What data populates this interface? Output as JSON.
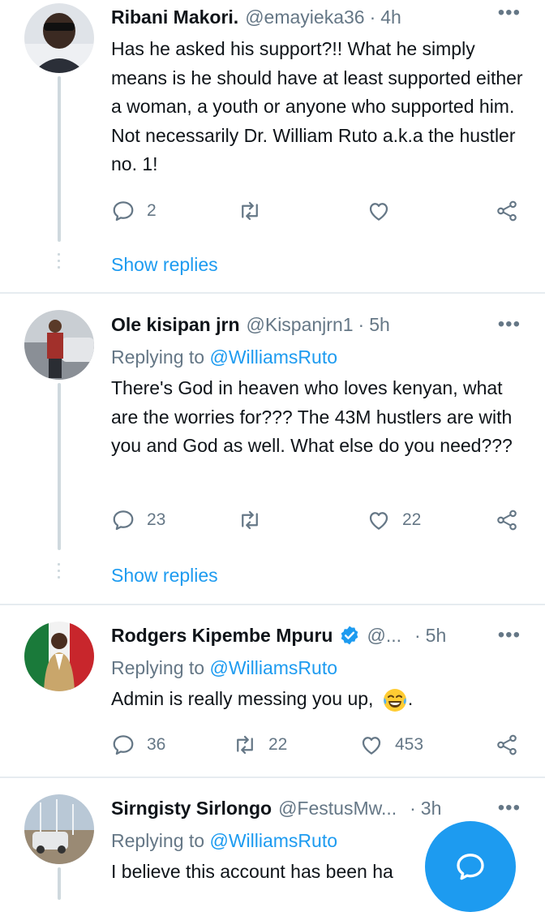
{
  "tweets": [
    {
      "name": "Ribani Makori.",
      "handle": "@emayieka36",
      "sep": "·",
      "time": "4h",
      "text": "Has he asked his support?!! What he simply means is he should have at least supported either a woman, a youth or anyone who supported him. Not necessarily Dr. William Ruto a.k.a the hustler no. 1!",
      "replies": "2",
      "retweets": "",
      "likes": "",
      "show_replies": "Show replies"
    },
    {
      "name": "Ole kisipan jrn",
      "handle": "@Kispanjrn1",
      "sep": "·",
      "time": "5h",
      "replying_prefix": "Replying to",
      "replying_to": "@WilliamsRuto",
      "text": "There's God in heaven who loves kenyan, what are the worries for??? The 43M hustlers are with you and God as well. What else do you need???",
      "replies": "23",
      "retweets": "",
      "likes": "22",
      "show_replies": "Show replies"
    },
    {
      "name": "Rodgers Kipembe Mpuru",
      "handle": "@...",
      "sep": "·",
      "time": "5h",
      "replying_prefix": "Replying to",
      "replying_to": "@WilliamsRuto",
      "text": "Admin is really messing you up,",
      "text_suffix": ".",
      "replies": "36",
      "retweets": "22",
      "likes": "453"
    },
    {
      "name": "Sirngisty Sirlongo",
      "handle": "@FestusMw...",
      "sep": "·",
      "time": "3h",
      "replying_prefix": "Replying to",
      "replying_to": "@WilliamsRuto",
      "text": "I believe this account has been ha"
    }
  ],
  "colors": {
    "accent": "#1d9bf0",
    "muted": "#657786",
    "text": "#0f1419",
    "line": "#cfd9de"
  },
  "icons": [
    "reply-icon",
    "retweet-icon",
    "like-icon",
    "share-icon",
    "more-icon",
    "verified-icon",
    "compose-reply-icon"
  ]
}
